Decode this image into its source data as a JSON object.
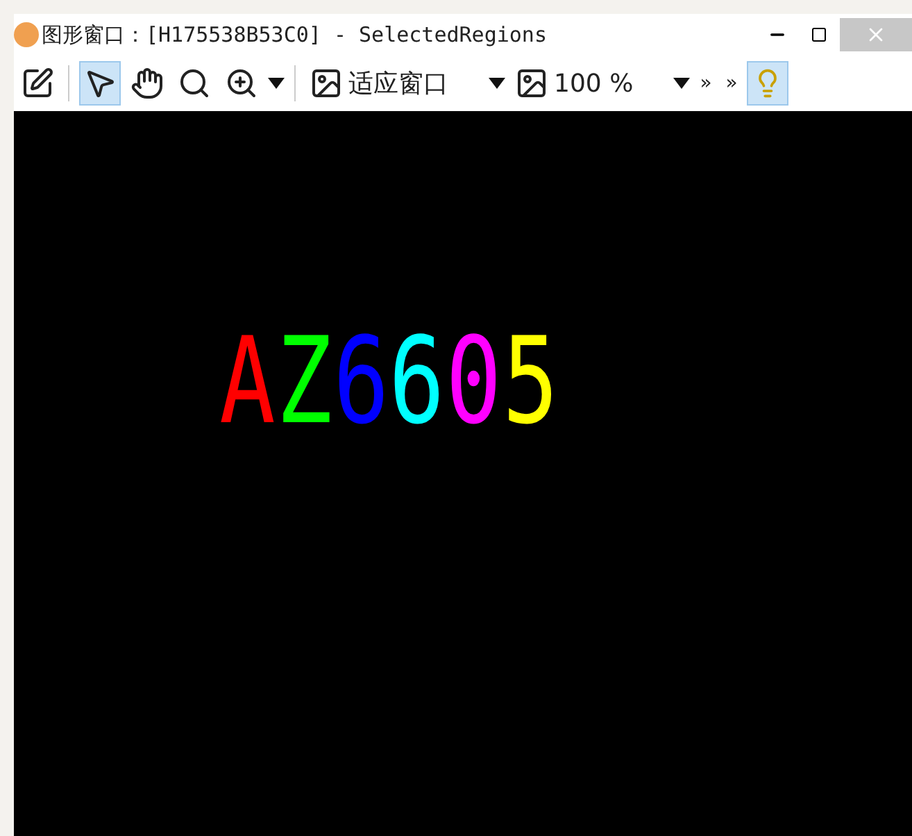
{
  "window": {
    "title": "图形窗口：[H175538B53C0] - SelectedRegions"
  },
  "toolbar": {
    "tools": [
      {
        "kind": "edit",
        "selected": false
      },
      {
        "kind": "pointer",
        "selected": true
      },
      {
        "kind": "pan",
        "selected": false
      },
      {
        "kind": "magnify",
        "selected": false
      },
      {
        "kind": "zoom",
        "selected": false
      }
    ],
    "fit_mode": "适应窗口",
    "zoom": "100 %",
    "overflow": [
      "»",
      "»"
    ],
    "help_selected": true
  },
  "regions": [
    {
      "label": "A",
      "color": "#ff0000"
    },
    {
      "label": "Z",
      "color": "#00ff00"
    },
    {
      "label": "6",
      "color": "#0000ff"
    },
    {
      "label": "6",
      "color": "#00ffff"
    },
    {
      "label": "0",
      "color": "#ff00ff"
    },
    {
      "label": "5",
      "color": "#ffff00"
    }
  ]
}
